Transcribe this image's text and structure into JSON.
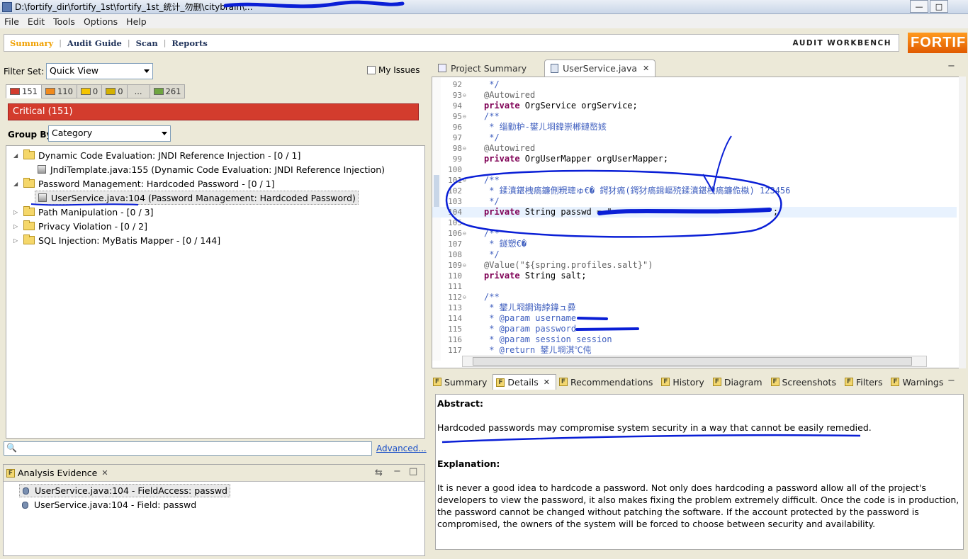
{
  "window": {
    "title": "D:\\fortify_dir\\fortify_1st\\fortify_1st_统计_勿删\\citybrain\\...",
    "minimize_label": "—",
    "maximize_label": "□"
  },
  "menu": [
    "File",
    "Edit",
    "Tools",
    "Options",
    "Help"
  ],
  "nav": {
    "items": [
      "Summary",
      "Audit Guide",
      "Scan",
      "Reports"
    ],
    "separator": "|",
    "workbench_label": "AUDIT WORKBENCH",
    "logo_text": "FORTIF"
  },
  "filter": {
    "label": "Filter Set:",
    "value": "Quick View",
    "my_issues_label": "My Issues"
  },
  "priority_tabs": [
    {
      "count": "151",
      "color": "#d33c2d"
    },
    {
      "count": "110",
      "color": "#f08a1c"
    },
    {
      "count": "0",
      "color": "#f5c400"
    },
    {
      "count": "0",
      "color": "#d4b000"
    },
    {
      "count": "...",
      "color": ""
    },
    {
      "count": "261",
      "color": "#6fa540"
    }
  ],
  "critical_bar": "Critical (151)",
  "group_by": {
    "label": "Group By:",
    "value": "Category"
  },
  "tree": [
    {
      "text": "Dynamic Code Evaluation: JNDI Reference Injection - [0 / 1]",
      "kind": "folder",
      "expanded": true
    },
    {
      "text": "JndiTemplate.java:155 (Dynamic Code Evaluation: JNDI Reference Injection)",
      "kind": "file"
    },
    {
      "text": "Password Management: Hardcoded Password - [0 / 1]",
      "kind": "folder",
      "expanded": true
    },
    {
      "text": "UserService.java:104 (Password Management: Hardcoded Password)",
      "kind": "file",
      "selected": true
    },
    {
      "text": "Path Manipulation - [0 / 3]",
      "kind": "folder"
    },
    {
      "text": "Privacy Violation - [0 / 2]",
      "kind": "folder"
    },
    {
      "text": "SQL Injection: MyBatis Mapper - [0 / 144]",
      "kind": "folder"
    }
  ],
  "search": {
    "advanced_label": "Advanced..."
  },
  "analysis_evidence": {
    "title": "Analysis Evidence",
    "rows": [
      {
        "text": "UserService.java:104 - FieldAccess: passwd",
        "selected": true
      },
      {
        "text": "UserService.java:104 - Field: passwd"
      }
    ]
  },
  "editor": {
    "tabs": [
      "Project Summary",
      "UserService.java"
    ],
    "lines": [
      {
        "n": "92",
        "code": " */",
        "type": "comment"
      },
      {
        "n": "93",
        "code": "@Autowired",
        "type": "annotation",
        "fold": true
      },
      {
        "n": "94",
        "code": "private OrgService orgService;",
        "type": "field"
      },
      {
        "n": "95",
        "code": "/**",
        "type": "comment",
        "fold": true
      },
      {
        "n": "96",
        "code": " * 缁勭粐-鐢ㄦ埛鍏崇郴鏈嶅姟",
        "type": "comment"
      },
      {
        "n": "97",
        "code": " */",
        "type": "comment"
      },
      {
        "n": "98",
        "code": "@Autowired",
        "type": "annotation",
        "fold": true
      },
      {
        "n": "99",
        "code": "private OrgUserMapper orgUserMapper;",
        "type": "field"
      },
      {
        "n": "100",
        "code": "",
        "type": "plain"
      },
      {
        "n": "101",
        "code": "/**",
        "type": "comment",
        "fold": true
      },
      {
        "n": "102",
        "code": " * 鍒濆鍖栧瘑鐮侀粯璁ゅ€� 鍔犲瘑(鍔犲瘑鍓嶇殑鍒濆鍖栧瘑鐮佹槸) 123456",
        "type": "comment"
      },
      {
        "n": "103",
        "code": " */",
        "type": "comment"
      },
      {
        "n": "104",
        "code": "private String passwd = \"",
        "type": "field_current",
        "tail": "\";"
      },
      {
        "n": "105",
        "code": "",
        "type": "plain"
      },
      {
        "n": "106",
        "code": "/**",
        "type": "comment",
        "fold": true
      },
      {
        "n": "107",
        "code": " * 鐩愬€�",
        "type": "comment"
      },
      {
        "n": "108",
        "code": " */",
        "type": "comment"
      },
      {
        "n": "109",
        "code": "@Value(\"${spring.profiles.salt}\")",
        "type": "value_annotation",
        "fold": true
      },
      {
        "n": "110",
        "code": "private String salt;",
        "type": "field"
      },
      {
        "n": "111",
        "code": "",
        "type": "plain"
      },
      {
        "n": "112",
        "code": "/**",
        "type": "comment",
        "fold": true
      },
      {
        "n": "113",
        "code": " * 鐢ㄦ埛鐧诲綍鍏ュ彛",
        "type": "comment"
      },
      {
        "n": "114",
        "code": " * @param username ",
        "type": "javadoc"
      },
      {
        "n": "115",
        "code": " * @param password ",
        "type": "javadoc"
      },
      {
        "n": "116",
        "code": " * @param session session",
        "type": "javadoc"
      },
      {
        "n": "117",
        "code": " * @return 鐢ㄦ埛淇℃伅",
        "type": "javadoc"
      }
    ]
  },
  "details_tabs": [
    "Summary",
    "Details",
    "Recommendations",
    "History",
    "Diagram",
    "Screenshots",
    "Filters",
    "Warnings"
  ],
  "details": {
    "abstract_heading": "Abstract:",
    "abstract_text": "Hardcoded passwords may compromise system security in a way that cannot be easily remedied.",
    "explanation_heading": "Explanation:",
    "explanation_text": "It is never a good idea to hardcode a password. Not only does hardcoding a password allow all of the project's developers to view the password, it also makes fixing the problem extremely difficult. Once the code is in production, the password cannot be changed without patching the software. If the account protected by the password is compromised, the owners of the system will be forced to choose between security and availability."
  },
  "colors": {
    "ink": "#0a1fd6",
    "critical": "#d33c2d"
  }
}
